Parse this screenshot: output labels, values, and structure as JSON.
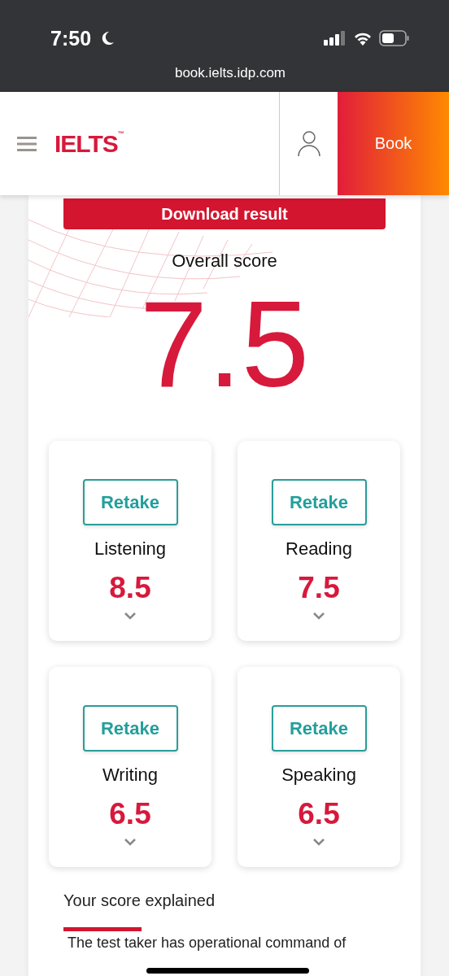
{
  "status_bar": {
    "time": "7:50",
    "url": "book.ielts.idp.com"
  },
  "header": {
    "logo": "IELTS",
    "logo_mark": "™",
    "book_button": "Book"
  },
  "download_button": "Download result",
  "overall": {
    "label": "Overall score",
    "score": "7.5"
  },
  "skills": [
    {
      "name": "Listening",
      "score": "8.5",
      "retake": "Retake"
    },
    {
      "name": "Reading",
      "score": "7.5",
      "retake": "Retake"
    },
    {
      "name": "Writing",
      "score": "6.5",
      "retake": "Retake"
    },
    {
      "name": "Speaking",
      "score": "6.5",
      "retake": "Retake"
    }
  ],
  "tabs": [
    {
      "label": "Your score explained",
      "selected": true
    }
  ],
  "explanation": "The test taker has operational command of"
}
